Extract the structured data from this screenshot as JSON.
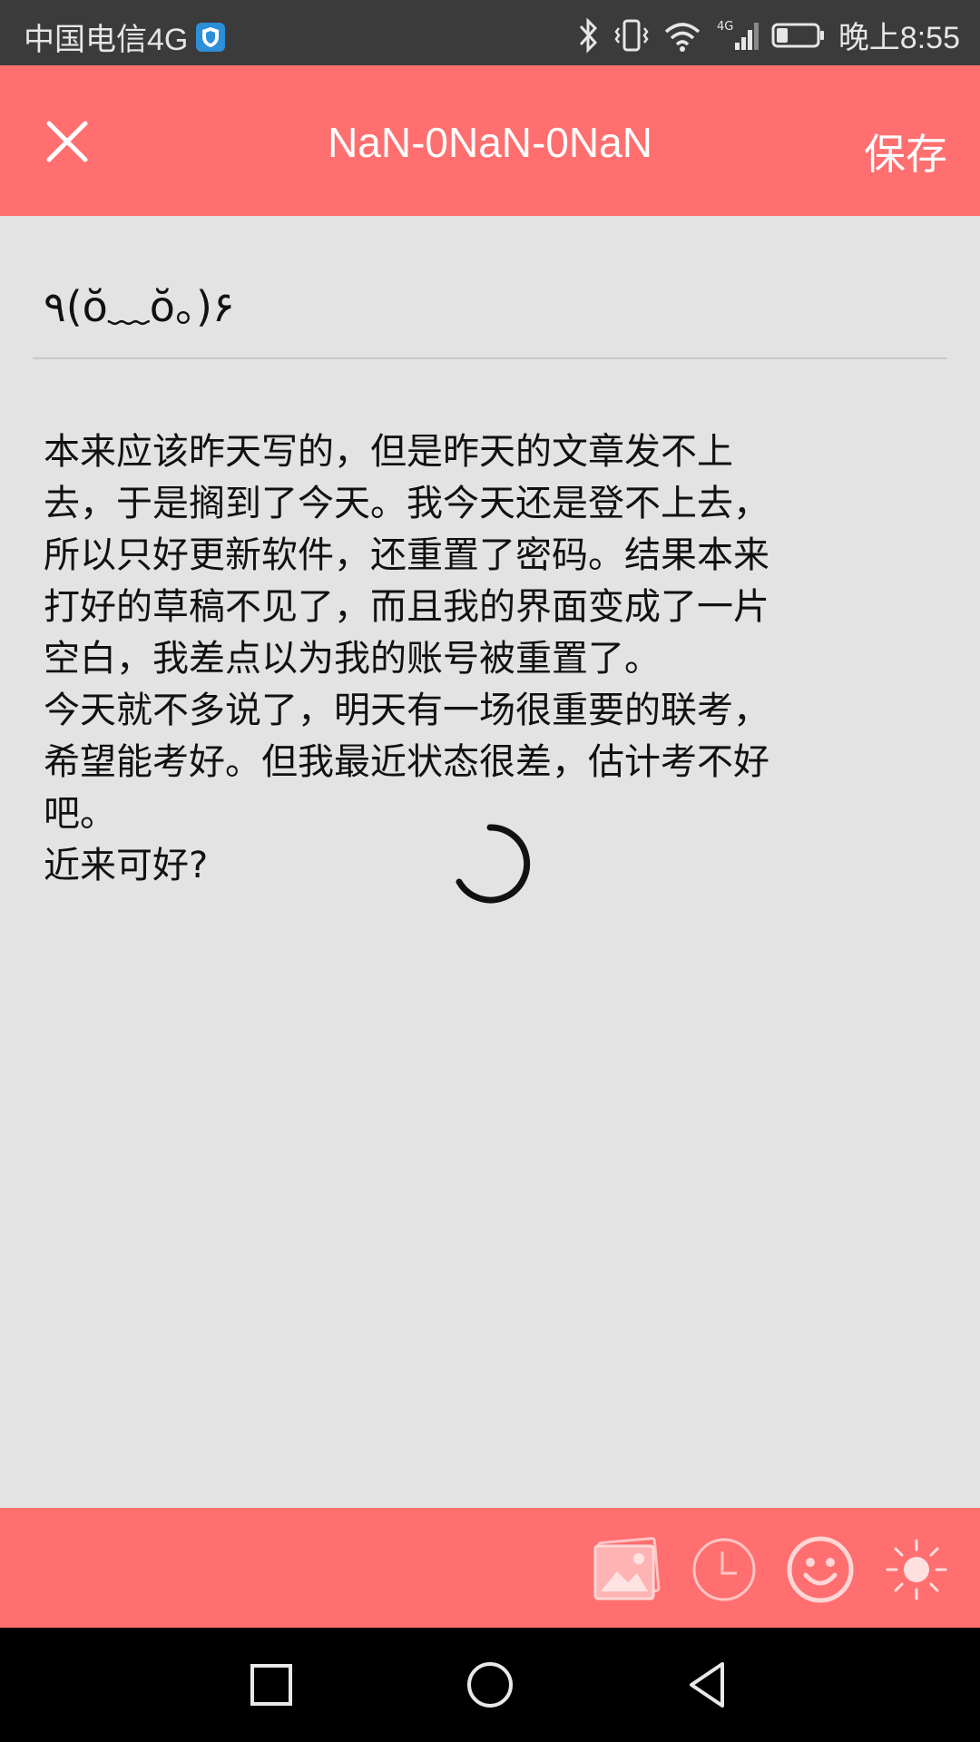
{
  "status_bar": {
    "carrier": "中国电信4G",
    "time": "晚上8:55"
  },
  "app_bar": {
    "title": "NaN-0NaN-0NaN",
    "save_label": "保存"
  },
  "editor": {
    "title_value": "٩(ŏ﹏ŏ。)۶",
    "body_lines": [
      "本来应该昨天写的，但是昨天的文章发不上",
      "去，于是搁到了今天。我今天还是登不上去，",
      "所以只好更新软件，还重置了密码。结果本来",
      "打好的草稿不见了，而且我的界面变成了一片",
      "空白，我差点以为我的账号被重置了。",
      "今天就不多说了，明天有一场很重要的联考，",
      "希望能考好。但我最近状态很差，估计考不好",
      "吧。",
      "近来可好?"
    ]
  },
  "toolbar": {
    "icons": [
      "image-icon",
      "clock-icon",
      "emoji-icon",
      "brightness-icon"
    ]
  },
  "colors": {
    "accent": "#ff6f6f",
    "background": "#e3e3e3",
    "status_bar": "#3b3b3b",
    "nav_bar": "#000000"
  }
}
